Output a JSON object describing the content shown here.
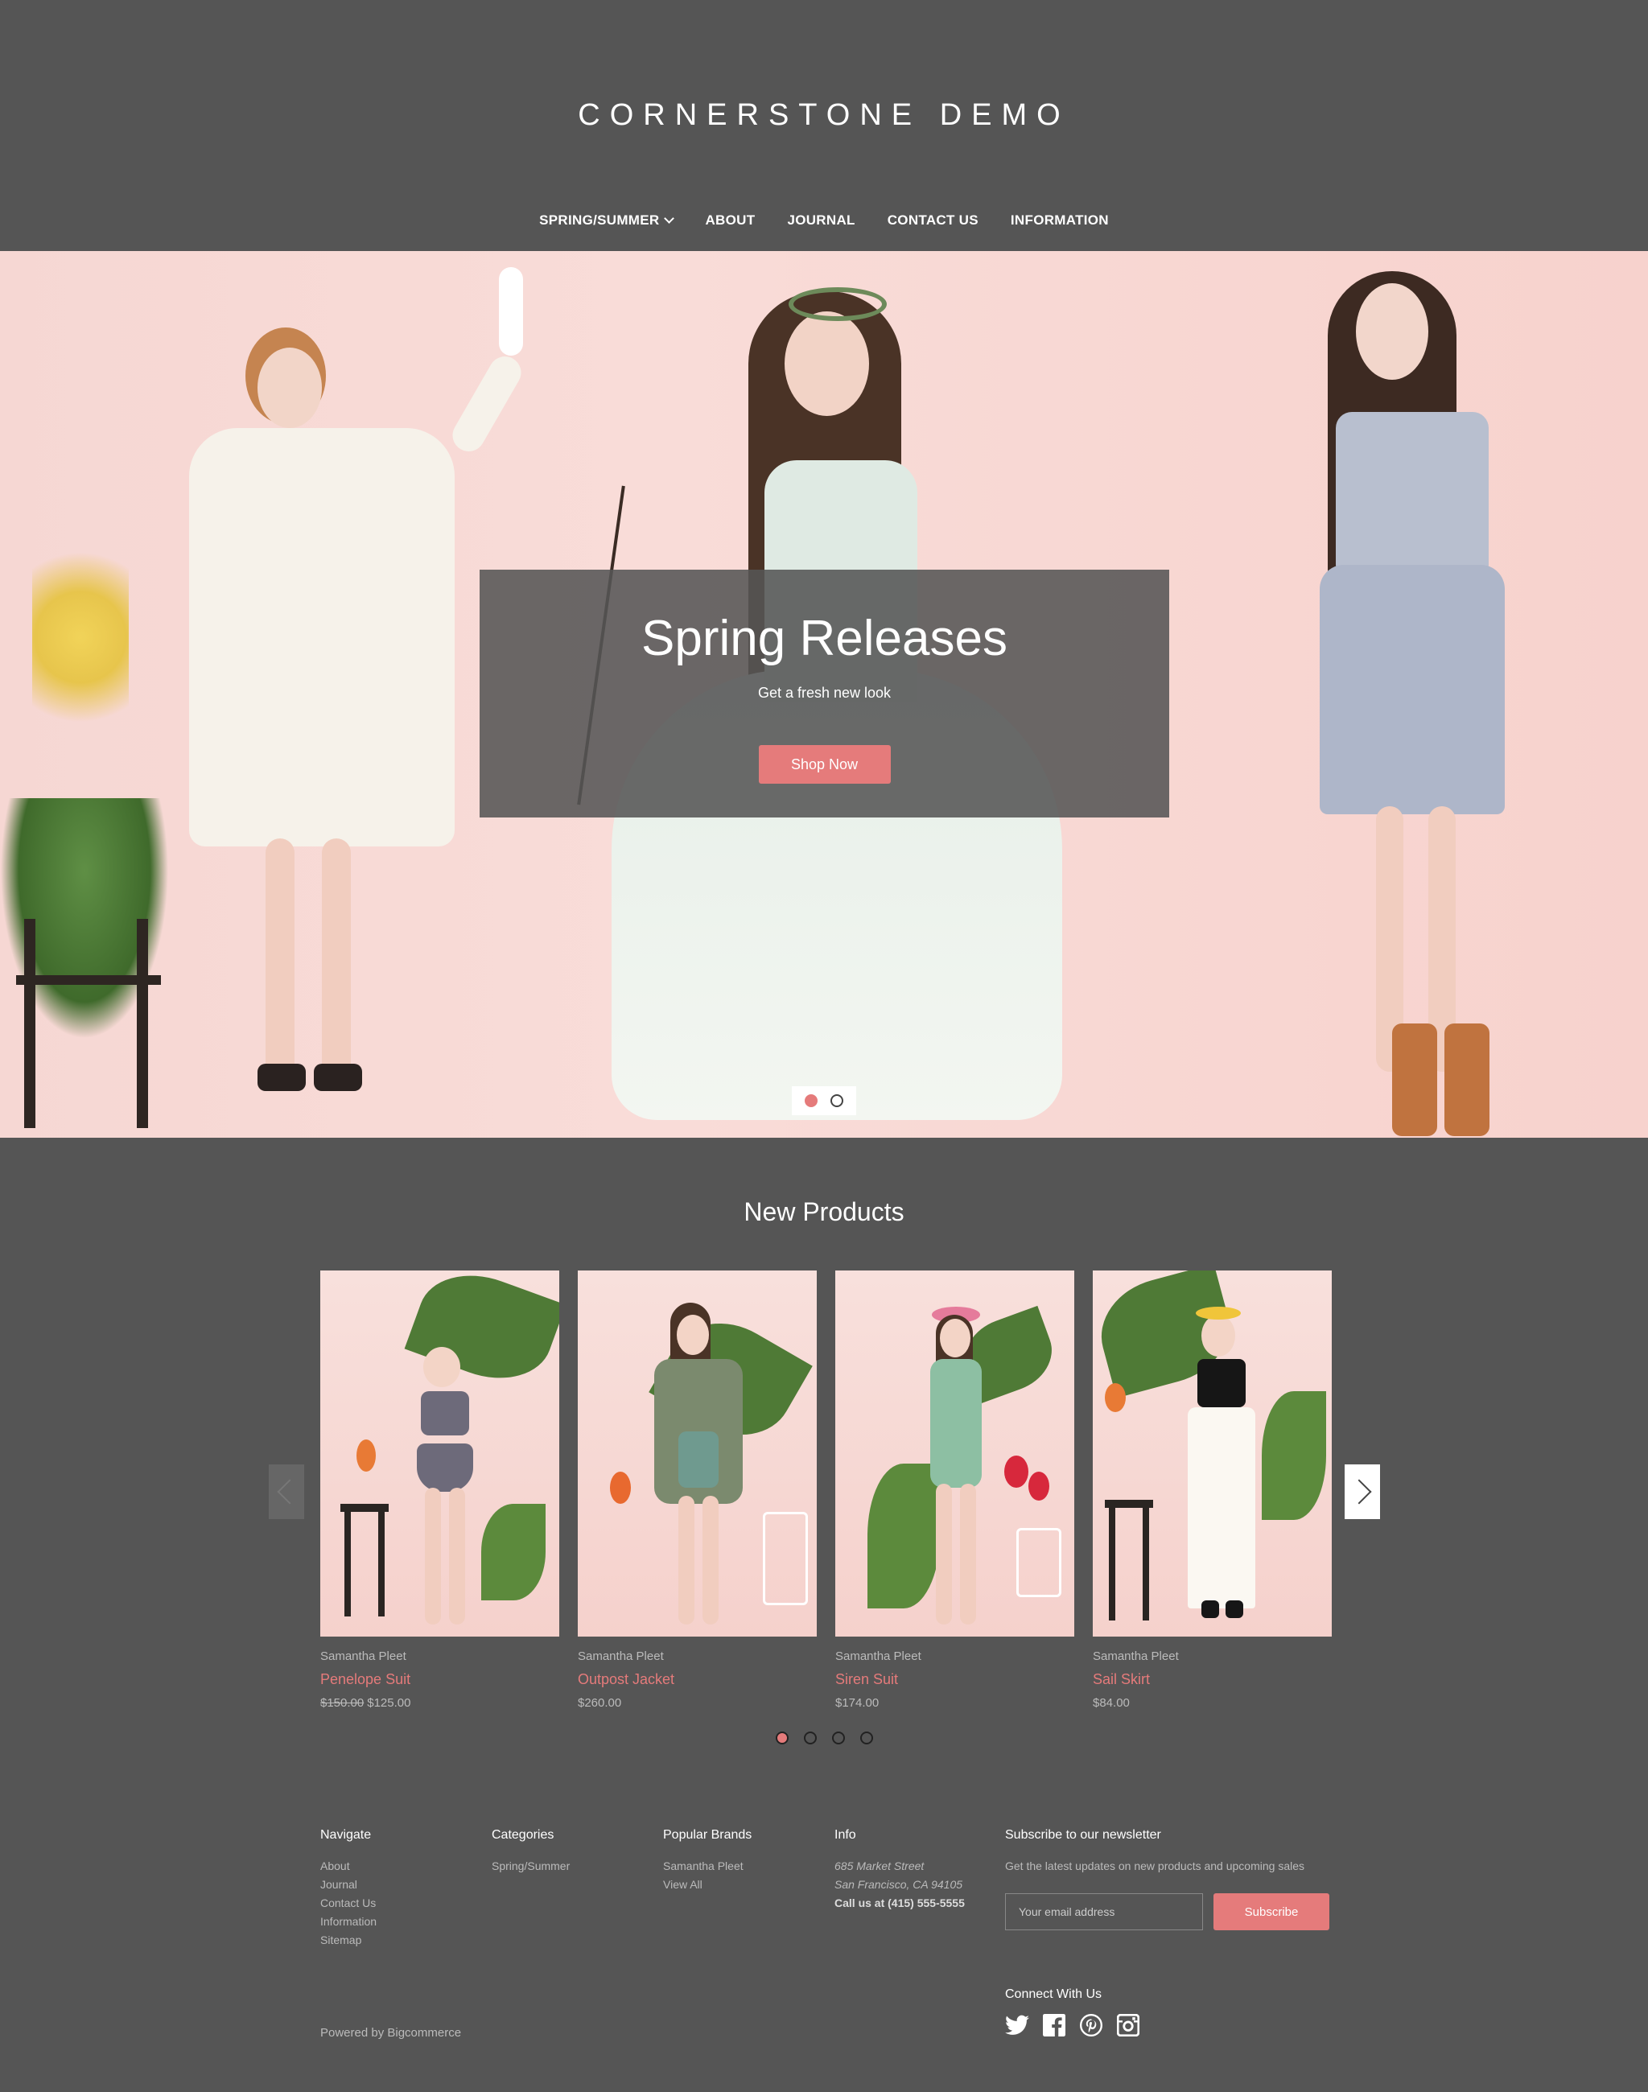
{
  "header": {
    "logo": "CORNERSTONE DEMO",
    "nav": [
      {
        "label": "SPRING/SUMMER",
        "has_dropdown": true
      },
      {
        "label": "ABOUT"
      },
      {
        "label": "JOURNAL"
      },
      {
        "label": "CONTACT US"
      },
      {
        "label": "INFORMATION"
      }
    ]
  },
  "hero": {
    "title": "Spring Releases",
    "subtitle": "Get a fresh new look",
    "button": "Shop Now",
    "slide_count": 2,
    "active_slide": 0
  },
  "products": {
    "section_title": "New Products",
    "items": [
      {
        "brand": "Samantha Pleet",
        "name": "Penelope Suit",
        "old_price": "$150.00",
        "price": "$125.00"
      },
      {
        "brand": "Samantha Pleet",
        "name": "Outpost Jacket",
        "old_price": "",
        "price": "$260.00"
      },
      {
        "brand": "Samantha Pleet",
        "name": "Siren Suit",
        "old_price": "",
        "price": "$174.00"
      },
      {
        "brand": "Samantha Pleet",
        "name": "Sail Skirt",
        "old_price": "",
        "price": "$84.00"
      }
    ],
    "page_count": 4,
    "active_page": 0
  },
  "footer": {
    "navigate": {
      "heading": "Navigate",
      "links": [
        "About",
        "Journal",
        "Contact Us",
        "Information",
        "Sitemap"
      ]
    },
    "categories": {
      "heading": "Categories",
      "links": [
        "Spring/Summer"
      ]
    },
    "brands": {
      "heading": "Popular Brands",
      "links": [
        "Samantha Pleet",
        "View All"
      ]
    },
    "info": {
      "heading": "Info",
      "address1": "685 Market Street",
      "address2": "San Francisco, CA 94105",
      "phone": "Call us at (415) 555-5555"
    },
    "newsletter": {
      "heading": "Subscribe to our newsletter",
      "description": "Get the latest updates on new products and upcoming sales",
      "placeholder": "Your email address",
      "button": "Subscribe"
    },
    "connect": {
      "heading": "Connect With Us",
      "icons": [
        "twitter-icon",
        "facebook-icon",
        "pinterest-icon",
        "instagram-icon"
      ]
    },
    "powered_by": "Powered by Bigcommerce"
  },
  "colors": {
    "background": "#555555",
    "accent": "#e57b7b"
  }
}
